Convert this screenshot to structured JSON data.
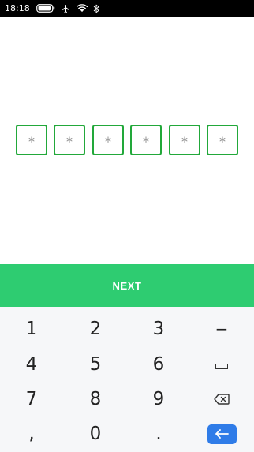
{
  "status_bar": {
    "time": "18:18",
    "icons": [
      "battery-icon",
      "airplane-mode-icon",
      "wifi-icon",
      "bluetooth-icon"
    ]
  },
  "pin": {
    "digits": [
      "*",
      "*",
      "*",
      "*",
      "*",
      "*"
    ],
    "border_color": "#22a83a"
  },
  "next_button": {
    "label": "NEXT",
    "color": "#2ecc71"
  },
  "keyboard": {
    "rows": [
      [
        "1",
        "2",
        "3",
        "−"
      ],
      [
        "4",
        "5",
        "6",
        "space"
      ],
      [
        "7",
        "8",
        "9",
        "backspace"
      ],
      [
        ",",
        "0",
        ".",
        "enter"
      ]
    ],
    "labels": {
      "k1": "1",
      "k2": "2",
      "k3": "3",
      "minus": "−",
      "k4": "4",
      "k5": "5",
      "k6": "6",
      "k7": "7",
      "k8": "8",
      "k9": "9",
      "comma": ",",
      "k0": "0",
      "period": "."
    },
    "enter_color": "#2f7ce8"
  }
}
